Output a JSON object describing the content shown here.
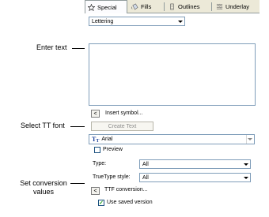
{
  "callouts": {
    "enter_text": "Enter text",
    "select_font": "Select TT font",
    "set_conversion_line1": "Set conversion",
    "set_conversion_line2": "values"
  },
  "tabs": [
    {
      "label": "Special",
      "icon": "star-icon",
      "active": true
    },
    {
      "label": "Fills",
      "icon": "fill-icon",
      "active": false
    },
    {
      "label": "Outlines",
      "icon": "outline-icon",
      "active": false
    },
    {
      "label": "Underlay",
      "icon": "underlay-icon",
      "active": false
    }
  ],
  "object_type": {
    "value": "Lettering"
  },
  "text_input": {
    "value": ""
  },
  "insert_symbol": {
    "button": "<",
    "label": "Insert symbol..."
  },
  "create_text": {
    "label": "Create Text"
  },
  "font": {
    "icon": "truetype-icon",
    "value": "Arial"
  },
  "preview": {
    "label": "Preview",
    "checked": false
  },
  "type": {
    "label": "Type:",
    "value": "All"
  },
  "truetype_style": {
    "label": "TrueType style:",
    "value": "All"
  },
  "ttf_conversion": {
    "button": "<",
    "label": "TTF conversion..."
  },
  "use_saved": {
    "label": "Use saved version",
    "checked": true
  },
  "colors": {
    "panel": "#ece9d8",
    "border": "#7f9db9",
    "disabled_text": "#8d8d8d"
  }
}
